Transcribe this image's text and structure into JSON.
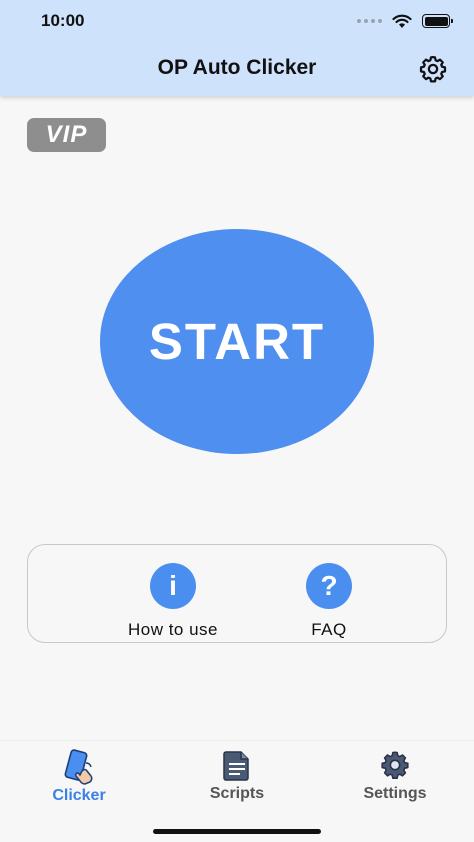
{
  "status_bar": {
    "time": "10:00",
    "battery_level": 1.0
  },
  "header": {
    "title": "OP Auto Clicker",
    "settings_icon": "gear-icon"
  },
  "vip": {
    "label": "VIP"
  },
  "main": {
    "start_label": "START",
    "accent": "#4f8ff0"
  },
  "help": {
    "items": [
      {
        "label": "How to use",
        "icon": "info-icon",
        "glyph": "i"
      },
      {
        "label": "FAQ",
        "icon": "question-icon",
        "glyph": "?"
      }
    ]
  },
  "tabs": [
    {
      "label": "Clicker",
      "icon": "phone-tap-icon",
      "active": true
    },
    {
      "label": "Scripts",
      "icon": "document-icon",
      "active": false
    },
    {
      "label": "Settings",
      "icon": "gear-icon",
      "active": false
    }
  ],
  "colors": {
    "header_bg": "#cfe2fb",
    "active_tab": "#3a82e8",
    "inactive_tab": "#555555"
  }
}
